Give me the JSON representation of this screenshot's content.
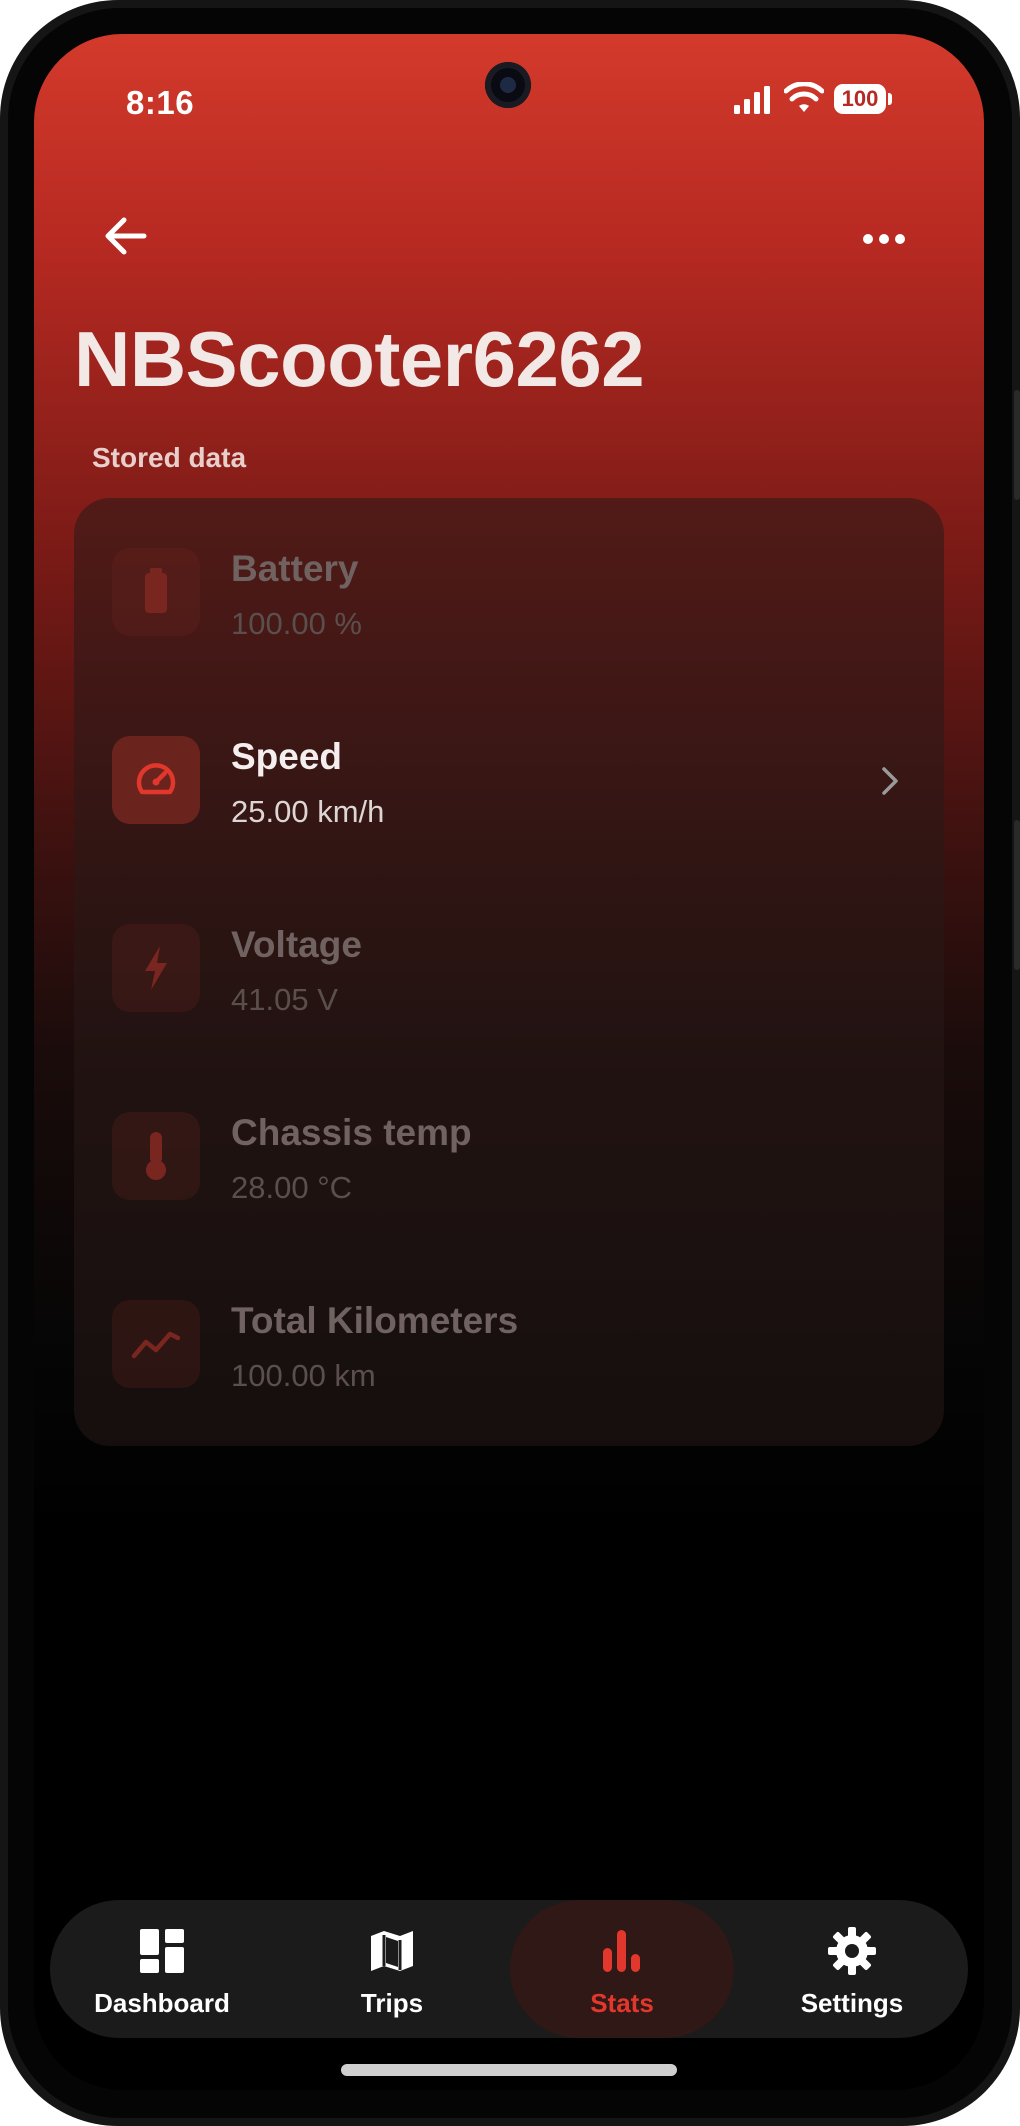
{
  "status_bar": {
    "time": "8:16",
    "battery_level": "100",
    "icons": [
      "signal-icon",
      "wifi-icon",
      "battery-icon"
    ]
  },
  "header": {
    "device_name": "NBScooter6262",
    "back_icon": "arrow-left-icon",
    "more_icon": "more-horizontal-icon"
  },
  "section_label": "Stored data",
  "items": [
    {
      "label": "Battery",
      "value": "100.00 %",
      "icon": "battery-icon",
      "active": false
    },
    {
      "label": "Speed",
      "value": "25.00 km/h",
      "icon": "speedometer-icon",
      "active": true
    },
    {
      "label": "Voltage",
      "value": "41.05 V",
      "icon": "lightning-icon",
      "active": false
    },
    {
      "label": "Chassis temp",
      "value": "28.00 °C",
      "icon": "thermometer-icon",
      "active": false
    },
    {
      "label": "Total Kilometers",
      "value": "100.00 km",
      "icon": "trend-line-icon",
      "active": false
    }
  ],
  "bottom_nav": [
    {
      "label": "Dashboard",
      "icon": "dashboard-icon",
      "active": false
    },
    {
      "label": "Trips",
      "icon": "map-icon",
      "active": false
    },
    {
      "label": "Stats",
      "icon": "bar-chart-icon",
      "active": true
    },
    {
      "label": "Settings",
      "icon": "gear-icon",
      "active": false
    }
  ],
  "colors": {
    "accent": "#e2372c",
    "header_red": "#d33a2b",
    "background": "#000000"
  }
}
